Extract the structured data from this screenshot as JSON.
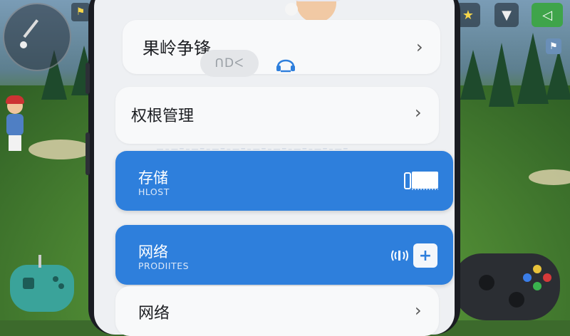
{
  "hud": {
    "flag_glyph": "⚑",
    "top_right_glyphs": [
      "★",
      "▼",
      "◁"
    ],
    "mini_glyph": "⚑"
  },
  "screen": {
    "top_card": {
      "title": "果岭争锋",
      "pill_text": "ᑎDᐸ",
      "chevron": "›"
    },
    "permission_card": {
      "title": "权根管理",
      "chevron": "›"
    },
    "storage_card": {
      "title": "存储",
      "subtitle": "HLOST"
    },
    "network_card": {
      "title": "网络",
      "subtitle": "PRODIITES",
      "plus": "+"
    },
    "bottom_card": {
      "title": "网络",
      "chevron": "›"
    }
  },
  "colors": {
    "accent_blue": "#2e7fdc",
    "card_bg": "#f8f9fa",
    "screen_bg": "#eef0f3"
  },
  "icons": [
    "headset-icon",
    "storage-device-icon",
    "signal-icon",
    "plus-icon",
    "chevron-right-icon"
  ]
}
